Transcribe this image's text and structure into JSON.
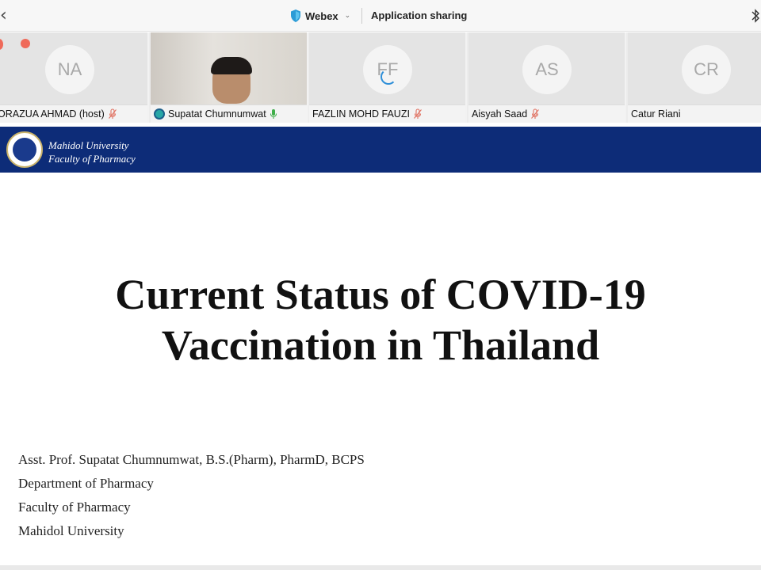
{
  "topbar": {
    "app_name": "Webex",
    "sharing_label": "Application sharing"
  },
  "participants": [
    {
      "initials": "NA",
      "name": "NORAZUA AHMAD (host)",
      "muted": true
    },
    {
      "initials": "",
      "name": "Supatat Chumnumwat",
      "muted": false,
      "video": true
    },
    {
      "initials": "FF",
      "name": "FAZLIN MOHD FAUZI",
      "muted": true
    },
    {
      "initials": "AS",
      "name": "Aisyah Saad",
      "muted": true
    },
    {
      "initials": "CR",
      "name": "Catur Riani",
      "muted": false
    }
  ],
  "slide": {
    "header_line1": "Mahidol University",
    "header_line2": "Faculty of Pharmacy",
    "title_line1": "Current Status of COVID-19",
    "title_line2": "Vaccination in Thailand",
    "presenter_lines": [
      "Asst. Prof. Supatat Chumnumwat, B.S.(Pharm), PharmD, BCPS",
      "Department of Pharmacy",
      "Faculty of Pharmacy",
      "Mahidol University"
    ]
  },
  "colors": {
    "slide_header": "#0d2c78",
    "mute_icon": "#e07060",
    "mic_active": "#3fae49"
  }
}
